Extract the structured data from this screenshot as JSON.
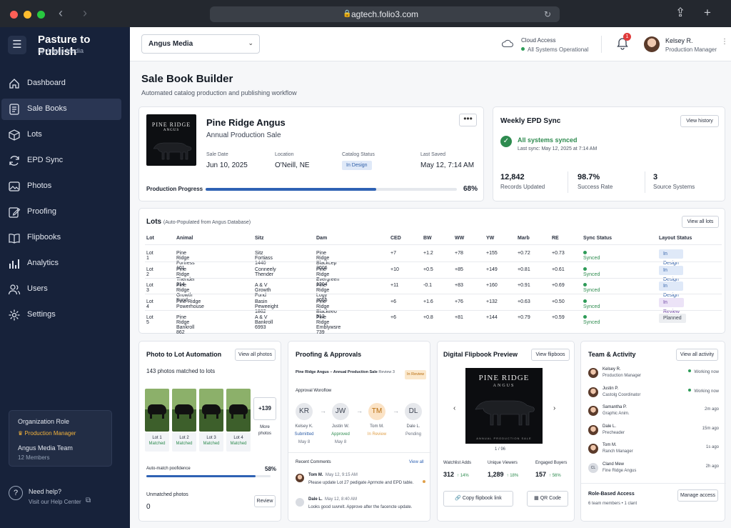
{
  "browser": {
    "url": "agtech.folio3.com"
  },
  "sidebar": {
    "brand": "Pasture to Publish",
    "brand_sub": "by Angus Media",
    "items": [
      {
        "label": "Dashboard",
        "icon": "home-icon"
      },
      {
        "label": "Sale Books",
        "icon": "book-list-icon"
      },
      {
        "label": "Lots",
        "icon": "box-icon"
      },
      {
        "label": "EPD Sync",
        "icon": "sync-icon"
      },
      {
        "label": "Photos",
        "icon": "image-icon"
      },
      {
        "label": "Proofing",
        "icon": "edit-icon"
      },
      {
        "label": "Flipbooks",
        "icon": "open-book-icon"
      },
      {
        "label": "Analytics",
        "icon": "bar-chart-icon"
      },
      {
        "label": "Users",
        "icon": "users-icon"
      },
      {
        "label": "Settings",
        "icon": "gear-icon"
      }
    ],
    "active_index": 1,
    "org": {
      "title": "Organization Role",
      "role": "Production Manager",
      "team": "Angus Media Team",
      "members": "12 Members"
    },
    "help": {
      "title": "Need help?",
      "link": "Visit our Help Center"
    }
  },
  "header": {
    "org_select": "Angus Media",
    "cloud_title": "Cloud Access",
    "cloud_status": "All Systems Operational",
    "notifications": "1",
    "user_name": "Kelsey R.",
    "user_role": "Production Manager"
  },
  "page": {
    "title": "Sale Book Builder",
    "subtitle": "Automated catalog production and publishing workflow"
  },
  "catalog": {
    "cover_title": "PINE RIDGE",
    "cover_sub": "ANGUS",
    "title": "Pine Ridge Angus",
    "subtitle": "Annual Production Sale",
    "more": "•••",
    "meta": [
      {
        "label": "Sale Date",
        "value": "Jun 10, 2025"
      },
      {
        "label": "Location",
        "value": "O'Neill, NE"
      },
      {
        "label": "Catalog Status",
        "value": "In Design"
      },
      {
        "label": "Last Saved",
        "value": "May 12, 7:14 AM"
      }
    ],
    "progress_label": "Production Progress",
    "progress_value": "68%",
    "progress": 0.68
  },
  "epd": {
    "title": "Weekly EPD Sync",
    "history_btn": "View history",
    "status": "All systems synced",
    "last_sync": "Last sync: May 12, 2025 at 7:14 AM",
    "stats": [
      {
        "value": "12,842",
        "label": "Records Updated"
      },
      {
        "value": "98.7%",
        "label": "Success Rate"
      },
      {
        "value": "3",
        "label": "Source Systems"
      }
    ]
  },
  "lots": {
    "title": "Lots",
    "subtitle": "(Auto-Populated from Angus Database)",
    "view_all": "View all lots",
    "columns": [
      "Lot",
      "Animal",
      "Sitz",
      "Dam",
      "CED",
      "BW",
      "WW",
      "YW",
      "Marb",
      "RE",
      "Sync Status",
      "Layout Status"
    ],
    "rows": [
      [
        "Lot 1",
        "Pine Ridge Fortress 101",
        "Sitz Fortiass 1440",
        "Pine Ridge Blackcep 2006",
        "+7",
        "+1.2",
        "+78",
        "+155",
        "+0.72",
        "+0.73",
        "Synced",
        "In Design"
      ],
      [
        "Lot 2",
        "Pine Ridge Thender 214",
        "Conneely Thender",
        "Pine Ridge Evergreen 1204",
        "+10",
        "+0.5",
        "+85",
        "+149",
        "+0.81",
        "+0.61",
        "Synced",
        "In Design"
      ],
      [
        "Lot 3",
        "Pine Ridge Growth Fund",
        "A & V Growth Fund",
        "Pine Ridge Logy 2055",
        "+11",
        "-0.1",
        "+83",
        "+160",
        "+0.91",
        "+0.69",
        "Synced",
        "In Design"
      ],
      [
        "Lot 4",
        "Pine Ridge Powerhouse",
        "Basin Peweeight 1862",
        "Pine Ridge Blackeeo 512",
        "+6",
        "+1.6",
        "+76",
        "+132",
        "+0.63",
        "+0.50",
        "Synced",
        "In Review"
      ],
      [
        "Lot 5",
        "Pine Ridge Bankroll 862",
        "A & V Bankroll 6993",
        "Pine Ridge Emblywsre 739",
        "+6",
        "+0.8",
        "+81",
        "+144",
        "+0.79",
        "+0.59",
        "Synced",
        "Planned"
      ]
    ]
  },
  "photos": {
    "title": "Photo to Lot Automation",
    "view_all": "View all photos",
    "matched": "143 photos matched to lots",
    "thumbs": [
      {
        "lot": "Lot 1",
        "status": "Matched"
      },
      {
        "lot": "Lot 2",
        "status": "Matched"
      },
      {
        "lot": "Lot 3",
        "status": "Matched"
      },
      {
        "lot": "Lot 4",
        "status": "Matched"
      }
    ],
    "more_count": "+139",
    "more_label": "More photos",
    "confidence_label": "Auto-match poofidence",
    "confidence_value": "58%",
    "confidence": 0.88,
    "unmatched_label": "Unmatched photos",
    "unmatched_value": "0",
    "review_btn": "Review"
  },
  "proofing": {
    "title": "Proofing & Approvals",
    "doc": "Pine Ridge Angus – Annual Production Sale",
    "doc_review": "Review 3",
    "doc_status": "In Review",
    "workflow_label": "Approval Woroflow",
    "steps": [
      {
        "initials": "KR",
        "name": "Kelsey K.",
        "status": "Submitted",
        "date": "May 8",
        "color": "#2f5fa8"
      },
      {
        "initials": "JW",
        "name": "Justin W.",
        "status": "Approved",
        "date": "May 8",
        "color": "#2e8b4f"
      },
      {
        "initials": "TM",
        "name": "Tom M.",
        "status": "In Review",
        "date": "",
        "color": "#e0a04a"
      },
      {
        "initials": "DL",
        "name": "Dale L.",
        "status": "Pending",
        "date": "",
        "color": "#6b7280"
      }
    ],
    "comments_label": "Recent Comments",
    "comments_view_all": "View all",
    "comments": [
      {
        "author": "Tom M.",
        "time": "May 12, 9:15 AM",
        "text": "Please update Lot 27 pedigate Aprmote and EPD table."
      },
      {
        "author": "Dale L.",
        "time": "May 12, 8:40 AM",
        "text": "Looks good suvrelt. Approve after the facencte update."
      }
    ]
  },
  "flipbook": {
    "title": "Digital Flipbook Preview",
    "view_btn": "View flipboos",
    "cover_title": "PINE RIDGE",
    "cover_sub": "ANGUS",
    "cover_caption": "ANNUAL PRODUCTION SALE",
    "page": "1 / 96",
    "stats": [
      {
        "label": "Watchlist Adds",
        "value": "312",
        "delta": "↑ 14%"
      },
      {
        "label": "Unique Viewers",
        "value": "1,289",
        "delta": "↑ 18%"
      },
      {
        "label": "Engaged Buyers",
        "value": "157",
        "delta": "↑ 56%"
      }
    ],
    "copy_btn": "Copy flipbook link",
    "qr_btn": "QR Code"
  },
  "team": {
    "title": "Team & Activity",
    "view_all": "View all activity",
    "members": [
      {
        "name": "Kelsey R.",
        "role": "Production Manager",
        "status": "Working now"
      },
      {
        "name": "Justin P.",
        "role": "Castolg Coordinator",
        "status": "Working now"
      },
      {
        "name": "Samantha P.",
        "role": "Graphic Anim.",
        "status": "2m ago"
      },
      {
        "name": "Dale L.",
        "role": "Precheader",
        "status": "15m ago"
      },
      {
        "name": "Tom M.",
        "role": "Ranch Manager",
        "status": "1s ago"
      },
      {
        "name": "Cland Mew",
        "role": "Fine Ridge Angus",
        "status": "2h ago",
        "initials": "CL"
      }
    ],
    "rbac_title": "Role-Based Access",
    "rbac_sub": "6 team members  •  1 clant",
    "manage_btn": "Manage access"
  },
  "colors": {
    "accent": "#2f62b4",
    "sidebar": "#17223a",
    "success": "#2e8b4f",
    "warning": "#e0a04a"
  }
}
